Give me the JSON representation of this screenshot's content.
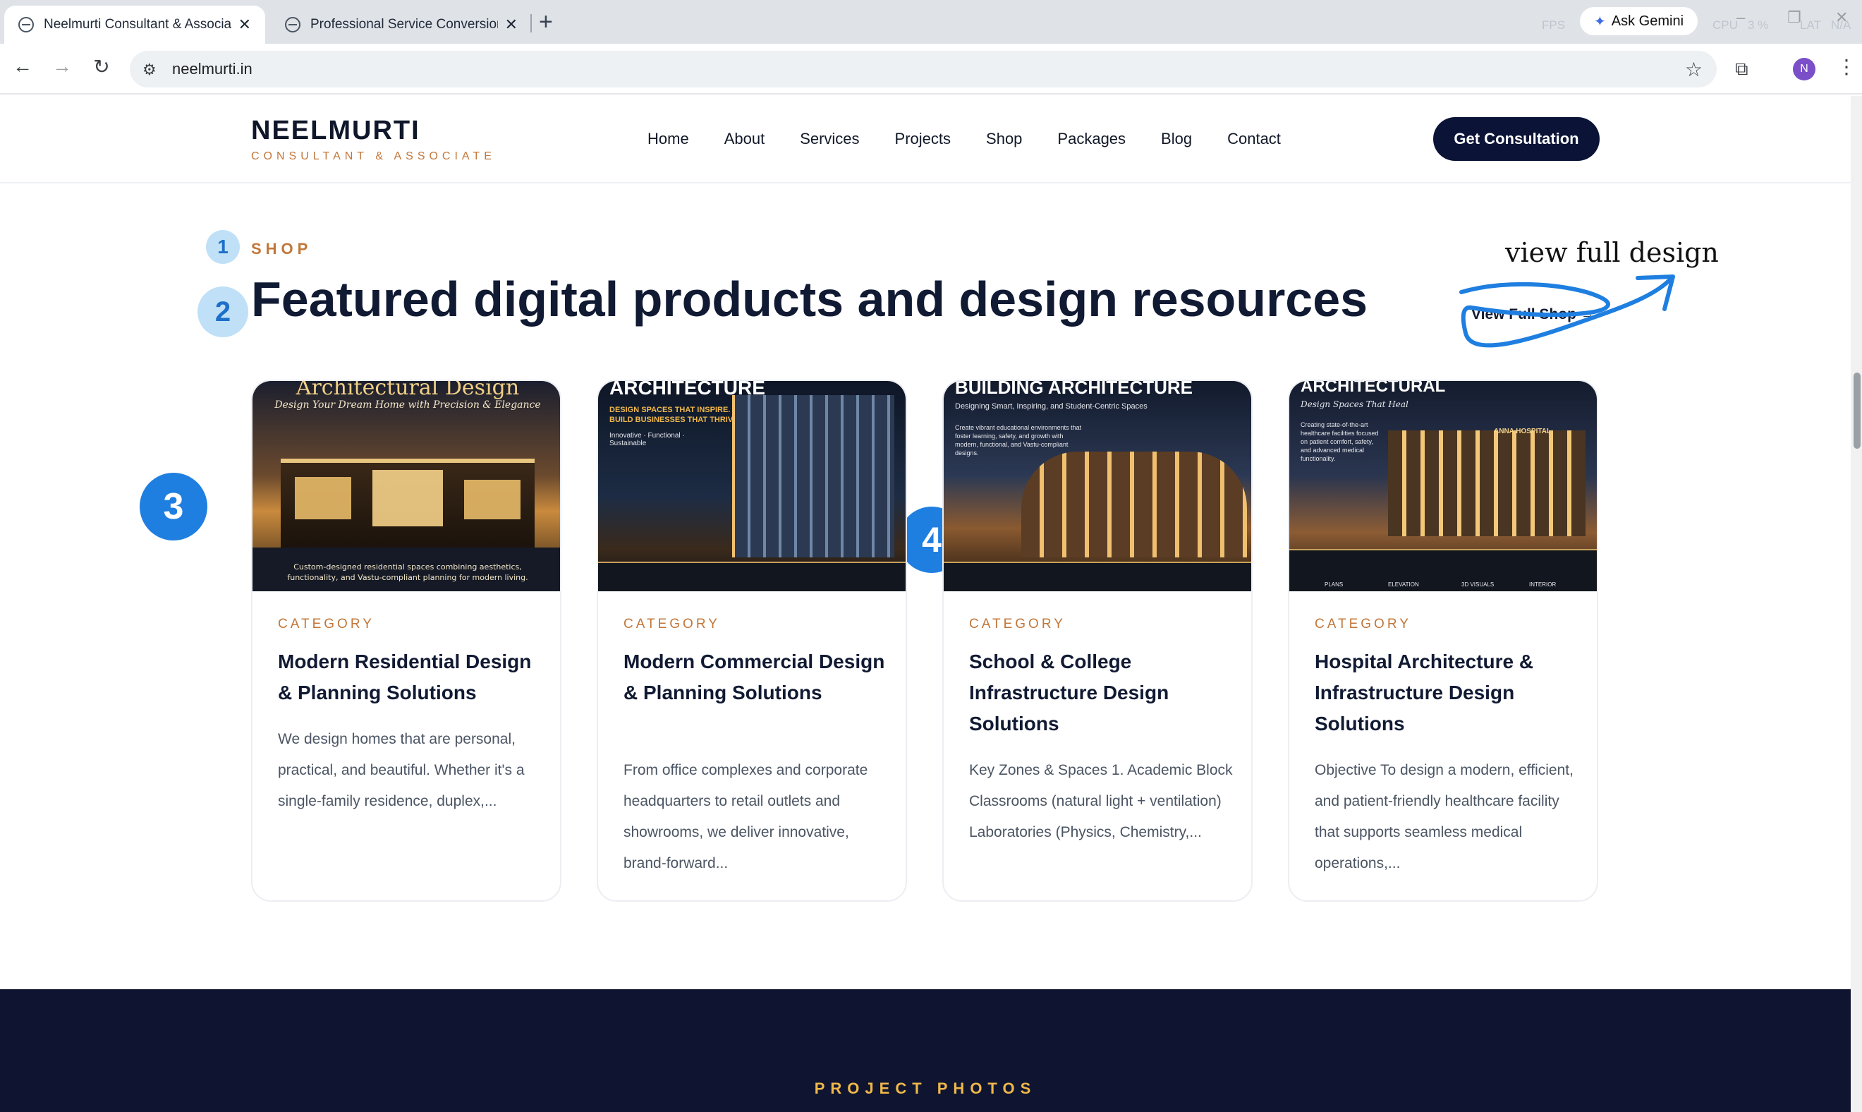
{
  "browser": {
    "tabs": [
      {
        "title": "Neelmurti Consultant & Associate",
        "active": true
      },
      {
        "title": "Professional Service Conversion",
        "active": false
      }
    ],
    "gemini_label": "Ask Gemini",
    "overlay": {
      "fps": "FPS",
      "cpu": "CPU",
      "cpu_val": "3 %",
      "lat": "LAT",
      "lat_val": "N/A"
    },
    "url": "neelmurti.in",
    "profile_initial": "N"
  },
  "site": {
    "brand_name": "NEELMURTI",
    "brand_tagline": "CONSULTANT & ASSOCIATE",
    "nav": [
      "Home",
      "About",
      "Services",
      "Projects",
      "Shop",
      "Packages",
      "Blog",
      "Contact"
    ],
    "cta": "Get Consultation"
  },
  "section": {
    "eyebrow": "SHOP",
    "heading": "Featured digital products and design resources",
    "view_link": "View Full Shop →"
  },
  "annotations": {
    "markers": [
      "1",
      "2",
      "3",
      "4"
    ],
    "handwritten": "view full design",
    "color": "#1f7fe0"
  },
  "cards": [
    {
      "img_heading": "Architectural Design",
      "img_sub": "Design Your Dream Home with Precision & Elegance",
      "img_foot": "Custom-designed residential spaces combining aesthetics, functionality, and Vastu-compliant planning for modern living.",
      "category": "CATEGORY",
      "title": "Modern Residential Design & Planning Solutions",
      "desc": "We design homes that are personal, practical, and beautiful. Whether it's a single-family residence, duplex,..."
    },
    {
      "img_heading": "ARCHITECTURE",
      "img_sub": "DESIGN SPACES THAT INSPIRE. BUILD BUSINESSES THAT THRIVE.",
      "img_foot": "Innovative · Functional · Sustainable",
      "category": "CATEGORY",
      "title": "Modern Commercial Design & Planning Solutions",
      "desc": "From office complexes and corporate headquarters to retail outlets and showrooms, we deliver innovative, brand-forward..."
    },
    {
      "img_heading": "BUILDING ARCHITECTURE",
      "img_sub": "Designing Smart, Inspiring, and Student-Centric Spaces",
      "img_foot": "Create vibrant educational environments that foster learning, safety, and growth with modern, functional, and Vastu-compliant designs.",
      "category": "CATEGORY",
      "title": "School & College Infrastructure Design Solutions",
      "desc": "Key Zones & Spaces 1. Academic Block Classrooms (natural light + ventilation) Laboratories (Physics, Chemistry,..."
    },
    {
      "img_heading": "ARCHITECTURAL",
      "img_sub": "Design Spaces That Heal",
      "img_foot": "Creating state-of-the-art healthcare facilities focused on patient comfort, safety, and advanced medical functionality.",
      "img_labels": [
        "PLANS",
        "ELEVATION",
        "3D VISUALS",
        "INTERIOR"
      ],
      "img_sign": "ANNA HOSPITAL",
      "category": "CATEGORY",
      "title": "Hospital Architecture & Infrastructure Design Solutions",
      "desc": "Objective To design a modern, efficient, and patient-friendly healthcare facility that supports seamless medical operations,..."
    }
  ],
  "next_section": {
    "label": "PROJECT PHOTOS"
  }
}
